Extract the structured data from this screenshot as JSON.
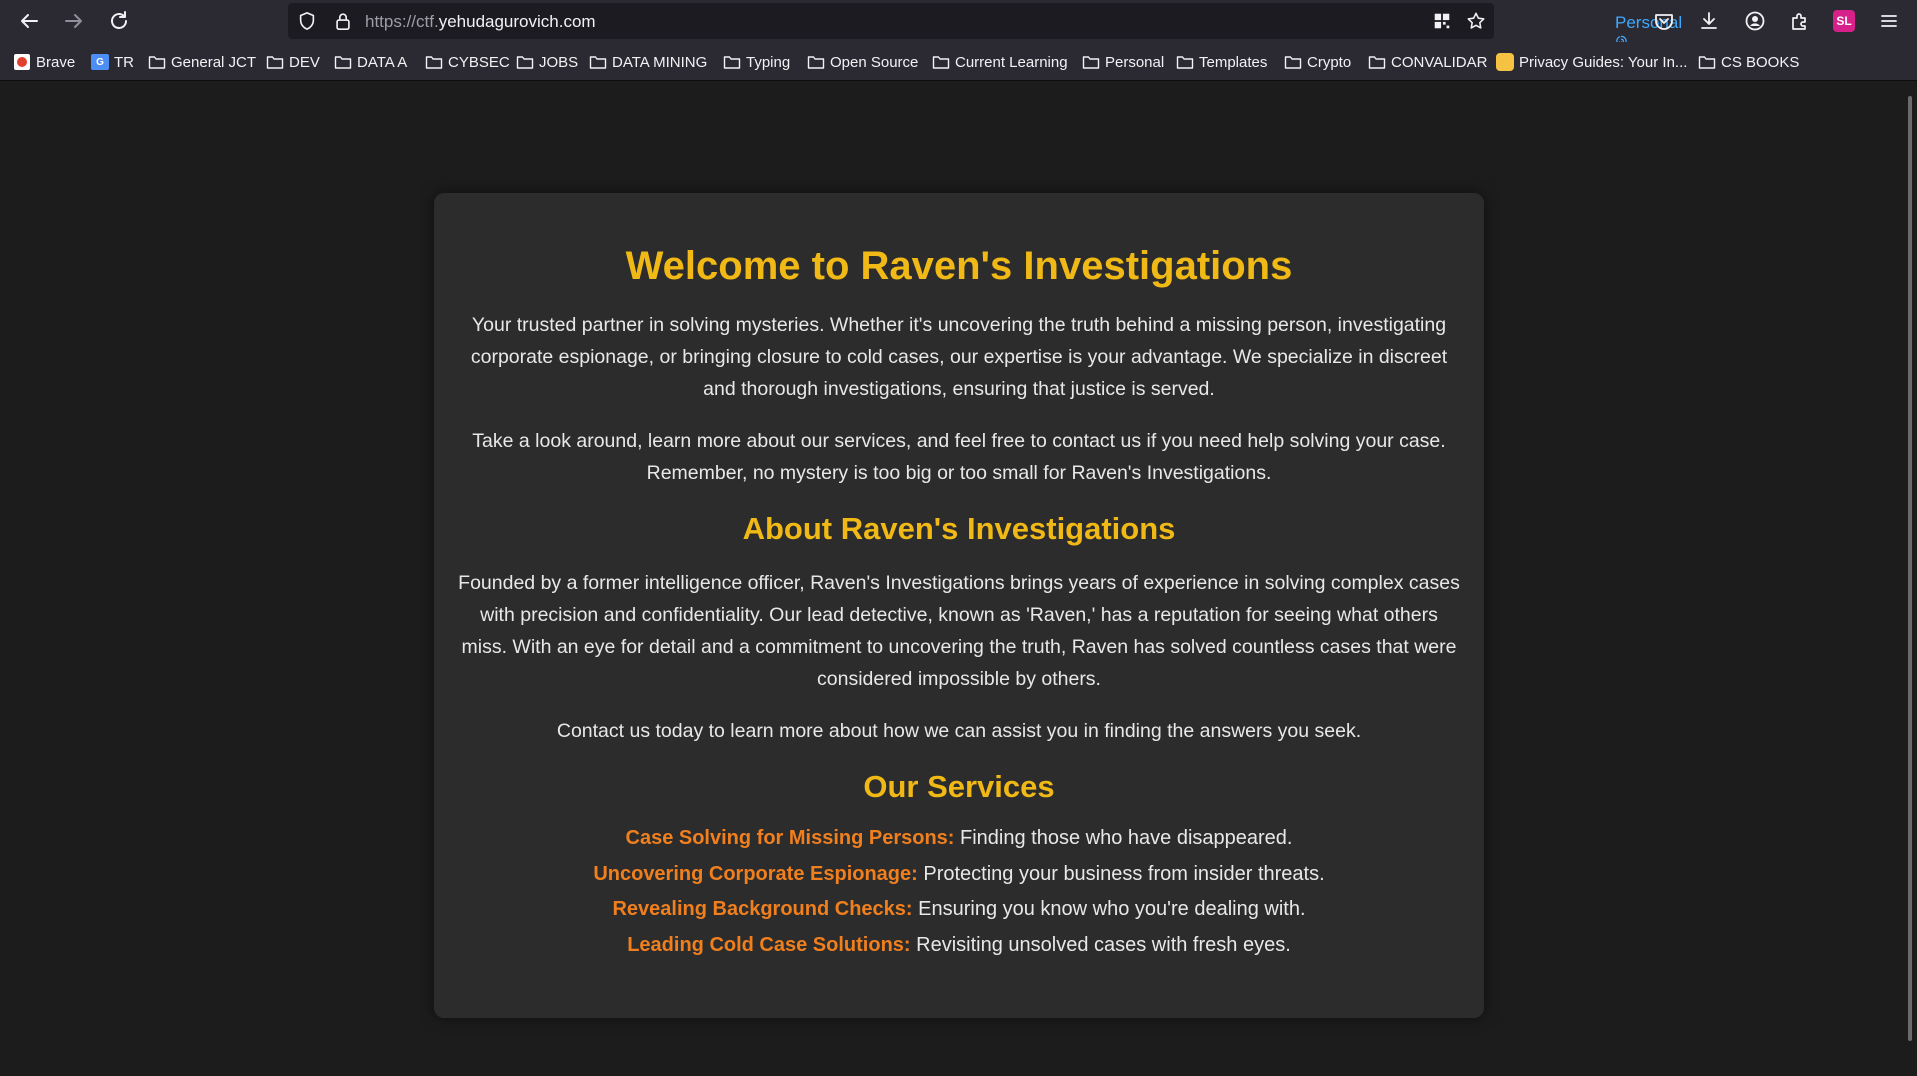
{
  "browser": {
    "url_prefix": "https://ctf.",
    "url_domain": "yehudagurovich.com",
    "container_label": "Personal",
    "profile_initials": "SL",
    "bookmarks": [
      {
        "label": "Brave",
        "type": "site"
      },
      {
        "label": "TR",
        "type": "site"
      },
      {
        "label": "General JCT",
        "type": "folder"
      },
      {
        "label": "DEV",
        "type": "folder"
      },
      {
        "label": "DATA A",
        "type": "folder"
      },
      {
        "label": "CYBSEC",
        "type": "folder"
      },
      {
        "label": "JOBS",
        "type": "folder"
      },
      {
        "label": "DATA MINING",
        "type": "folder"
      },
      {
        "label": "Typing",
        "type": "folder"
      },
      {
        "label": "Open Source",
        "type": "folder"
      },
      {
        "label": "Current Learning",
        "type": "folder"
      },
      {
        "label": "Personal",
        "type": "folder"
      },
      {
        "label": "Templates",
        "type": "folder"
      },
      {
        "label": "Crypto",
        "type": "folder"
      },
      {
        "label": "CONVALIDAR",
        "type": "folder"
      },
      {
        "label": "Privacy Guides: Your In...",
        "type": "site"
      },
      {
        "label": "CS BOOKS",
        "type": "folder"
      }
    ]
  },
  "page": {
    "title": "Welcome to Raven's Investigations",
    "intro_1": "Your trusted partner in solving mysteries. Whether it's uncovering the truth behind a missing person, investigating corporate espionage, or bringing closure to cold cases, our expertise is your advantage. We specialize in discreet and thorough investigations, ensuring that justice is served.",
    "intro_2": "Take a look around, learn more about our services, and feel free to contact us if you need help solving your case. Remember, no mystery is too big or too small for Raven's Investigations.",
    "about_heading": "About Raven's Investigations",
    "about_text": "Founded by a former intelligence officer, Raven's Investigations brings years of experience in solving complex cases with precision and confidentiality. Our lead detective, known as 'Raven,' has a reputation for seeing what others miss. With an eye for detail and a commitment to uncovering the truth, Raven has solved countless cases that were considered impossible by others.",
    "contact_text": "Contact us today to learn more about how we can assist you in finding the answers you seek.",
    "services_heading": "Our Services",
    "services": [
      {
        "name": "Case Solving for Missing Persons:",
        "desc": " Finding those who have disappeared."
      },
      {
        "name": "Uncovering Corporate Espionage:",
        "desc": " Protecting your business from insider threats."
      },
      {
        "name": "Revealing Background Checks:",
        "desc": " Ensuring you know who you're dealing with."
      },
      {
        "name": "Leading Cold Case Solutions:",
        "desc": " Revisiting unsolved cases with fresh eyes."
      }
    ]
  },
  "colors": {
    "heading": "#f0b915",
    "service_name": "#f07f1e",
    "background": "#1c1c1c",
    "card": "#2c2c2c",
    "container_accent": "#3da9ff",
    "profile_badge": "#d7208a"
  }
}
